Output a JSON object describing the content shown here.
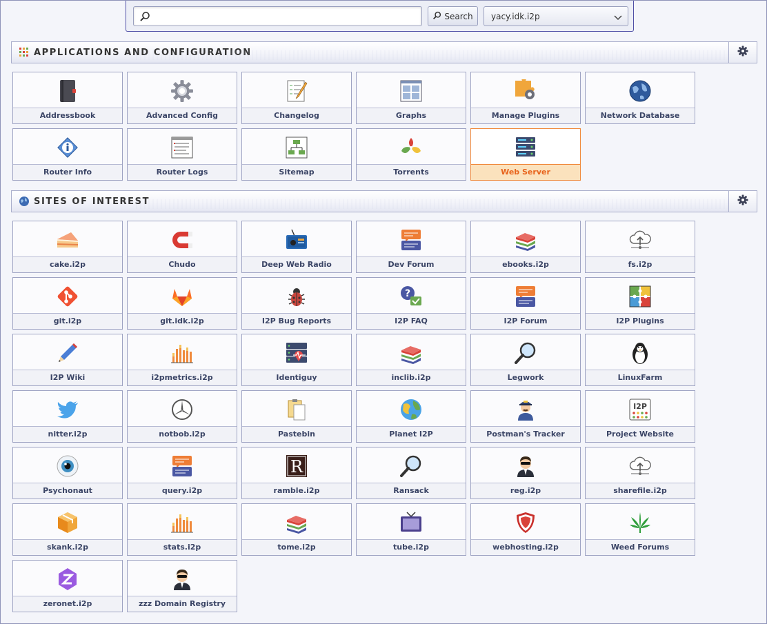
{
  "search": {
    "placeholder": "",
    "button_label": "Search",
    "engine_selected": "yacy.idk.i2p"
  },
  "apps": {
    "title": "APPLICATIONS AND CONFIGURATION",
    "items": [
      {
        "label": "Addressbook",
        "icon": "addressbook-icon"
      },
      {
        "label": "Advanced Config",
        "icon": "gear-icon"
      },
      {
        "label": "Changelog",
        "icon": "changelog-icon"
      },
      {
        "label": "Graphs",
        "icon": "graphs-icon"
      },
      {
        "label": "Manage Plugins",
        "icon": "plugins-icon"
      },
      {
        "label": "Network Database",
        "icon": "globe-icon"
      },
      {
        "label": "Router Info",
        "icon": "info-icon"
      },
      {
        "label": "Router Logs",
        "icon": "logs-icon"
      },
      {
        "label": "Sitemap",
        "icon": "sitemap-icon"
      },
      {
        "label": "Torrents",
        "icon": "torrents-icon"
      },
      {
        "label": "Web Server",
        "icon": "server-icon",
        "active": true
      }
    ]
  },
  "sites": {
    "title": "SITES OF INTEREST",
    "items": [
      {
        "label": "cake.i2p",
        "icon": "cake-icon"
      },
      {
        "label": "Chudo",
        "icon": "magnet-icon"
      },
      {
        "label": "Deep Web Radio",
        "icon": "radio-icon"
      },
      {
        "label": "Dev Forum",
        "icon": "forum-icon"
      },
      {
        "label": "ebooks.i2p",
        "icon": "books-icon"
      },
      {
        "label": "fs.i2p",
        "icon": "cloud-upload-icon"
      },
      {
        "label": "git.i2p",
        "icon": "git-icon"
      },
      {
        "label": "git.idk.i2p",
        "icon": "gitlab-icon"
      },
      {
        "label": "I2P Bug Reports",
        "icon": "bug-icon"
      },
      {
        "label": "I2P FAQ",
        "icon": "faq-icon"
      },
      {
        "label": "I2P Forum",
        "icon": "forum-icon"
      },
      {
        "label": "I2P Plugins",
        "icon": "puzzle-icon"
      },
      {
        "label": "I2P Wiki",
        "icon": "pen-icon"
      },
      {
        "label": "i2pmetrics.i2p",
        "icon": "bar-chart-icon"
      },
      {
        "label": "Identiguy",
        "icon": "server-heartbeat-icon"
      },
      {
        "label": "inclib.i2p",
        "icon": "books-icon"
      },
      {
        "label": "Legwork",
        "icon": "magnifier-icon"
      },
      {
        "label": "LinuxFarm",
        "icon": "penguin-icon"
      },
      {
        "label": "nitter.i2p",
        "icon": "bird-icon"
      },
      {
        "label": "notbob.i2p",
        "icon": "mercedes-icon"
      },
      {
        "label": "Pastebin",
        "icon": "clipboard-icon"
      },
      {
        "label": "Planet I2P",
        "icon": "planet-icon"
      },
      {
        "label": "Postman's Tracker",
        "icon": "postman-icon"
      },
      {
        "label": "Project Website",
        "icon": "i2p-logo-icon"
      },
      {
        "label": "Psychonaut",
        "icon": "eye-icon"
      },
      {
        "label": "query.i2p",
        "icon": "forum-icon"
      },
      {
        "label": "ramble.i2p",
        "icon": "r-letter-icon"
      },
      {
        "label": "Ransack",
        "icon": "magnifier-icon"
      },
      {
        "label": "reg.i2p",
        "icon": "agent-icon"
      },
      {
        "label": "sharefile.i2p",
        "icon": "cloud-upload-icon"
      },
      {
        "label": "skank.i2p",
        "icon": "box-icon"
      },
      {
        "label": "stats.i2p",
        "icon": "bar-chart-icon"
      },
      {
        "label": "tome.i2p",
        "icon": "books-icon"
      },
      {
        "label": "tube.i2p",
        "icon": "tv-icon"
      },
      {
        "label": "webhosting.i2p",
        "icon": "shield-icon"
      },
      {
        "label": "Weed Forums",
        "icon": "leaf-icon"
      },
      {
        "label": "zeronet.i2p",
        "icon": "zeronet-icon"
      },
      {
        "label": "zzz Domain Registry",
        "icon": "agent-icon"
      }
    ]
  },
  "colors": {
    "accent": "#4f4fa6",
    "active_label": "#e8641d",
    "active_label_bg": "#fbe2bd",
    "label_text": "#3b4566"
  }
}
